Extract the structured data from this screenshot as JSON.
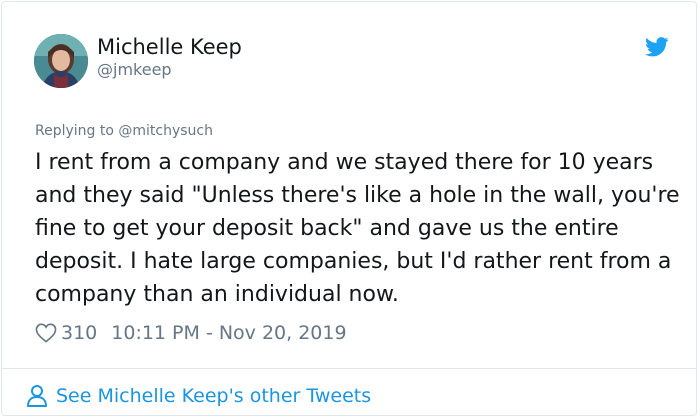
{
  "tweet": {
    "author": {
      "display_name": "Michelle Keep",
      "handle": "@jmkeep"
    },
    "replying_prefix": "Replying to",
    "replying_to": "@mitchysuch",
    "text": "I rent from a company and we stayed there for 10 years and they said \"Unless there's like a hole in the wall, you're fine to get your deposit back\" and gave us the entire deposit. I hate large companies, but I'd rather rent from a company than an individual now.",
    "likes": "310",
    "timestamp": "10:11 PM - Nov 20, 2019"
  },
  "footer": {
    "link_label": "See Michelle Keep's other Tweets"
  },
  "icons": {
    "logo": "twitter-bird-icon",
    "like": "heart-icon",
    "footer": "person-icon"
  },
  "colors": {
    "twitter_blue": "#1da1f2",
    "link_blue": "#1b95e0",
    "secondary_text": "#657786",
    "primary_text": "#14171a",
    "border": "#e1e8ed"
  }
}
